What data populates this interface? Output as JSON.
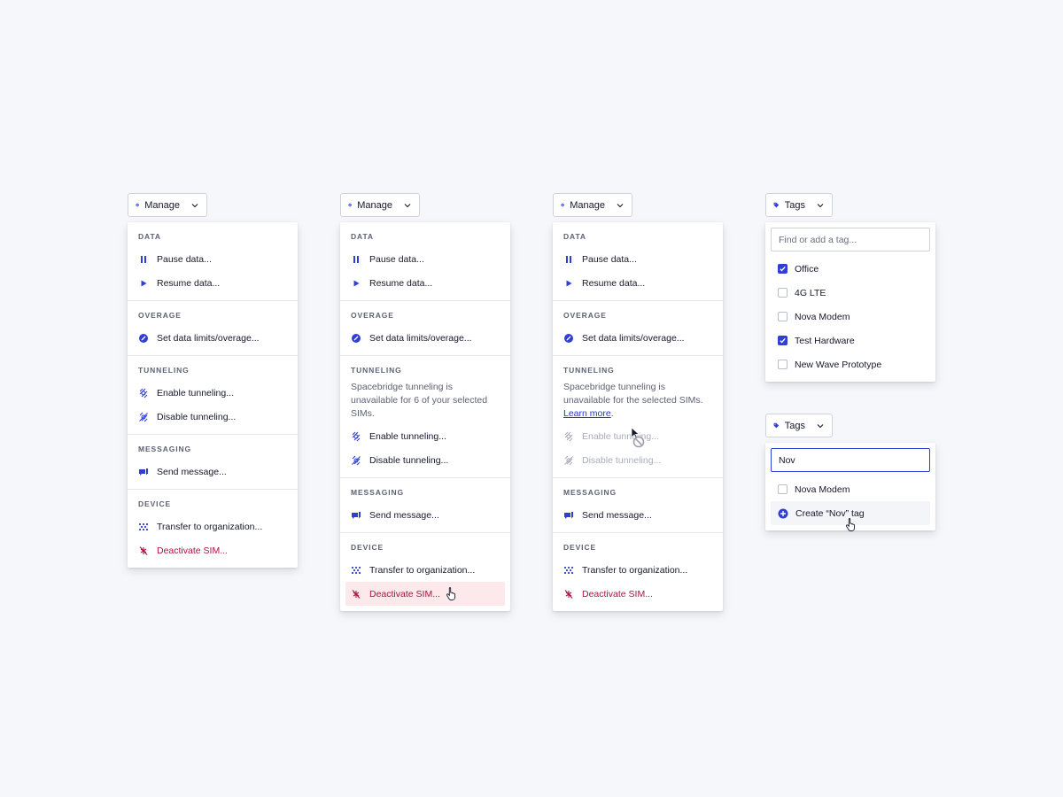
{
  "colors": {
    "accent": "#2f3fd6",
    "danger": "#b0113f",
    "danger_bg": "#fde8ec",
    "muted": "#5d6274"
  },
  "manage_menus": [
    {
      "trigger_label": "Manage",
      "sections": {
        "data": {
          "title": "DATA",
          "items": [
            "Pause data...",
            "Resume data..."
          ]
        },
        "overage": {
          "title": "OVERAGE",
          "items": [
            "Set data limits/overage..."
          ]
        },
        "tunneling": {
          "title": "TUNNELING",
          "items": [
            "Enable tunneling...",
            "Disable tunneling..."
          ]
        },
        "messaging": {
          "title": "MESSAGING",
          "items": [
            "Send message..."
          ]
        },
        "device": {
          "title": "DEVICE",
          "items": [
            "Transfer to organization...",
            "Deactivate SIM..."
          ]
        }
      }
    },
    {
      "trigger_label": "Manage",
      "sections": {
        "data": {
          "title": "DATA",
          "items": [
            "Pause data...",
            "Resume data..."
          ]
        },
        "overage": {
          "title": "OVERAGE",
          "items": [
            "Set data limits/overage..."
          ]
        },
        "tunneling": {
          "title": "TUNNELING",
          "note": "Spacebridge tunneling is unavailable for 6 of your selected SIMs.",
          "items": [
            "Enable tunneling...",
            "Disable tunneling..."
          ]
        },
        "messaging": {
          "title": "MESSAGING",
          "items": [
            "Send message..."
          ]
        },
        "device": {
          "title": "DEVICE",
          "items": [
            "Transfer to organization...",
            "Deactivate SIM..."
          ]
        }
      }
    },
    {
      "trigger_label": "Manage",
      "sections": {
        "data": {
          "title": "DATA",
          "items": [
            "Pause data...",
            "Resume data..."
          ]
        },
        "overage": {
          "title": "OVERAGE",
          "items": [
            "Set data limits/overage..."
          ]
        },
        "tunneling": {
          "title": "TUNNELING",
          "note": "Spacebridge tunneling is unavailable for the selected SIMs.",
          "note_link": "Learn more",
          "note_end": ".",
          "items": [
            "Enable tunneling...",
            "Disable tunneling..."
          ]
        },
        "messaging": {
          "title": "MESSAGING",
          "items": [
            "Send message..."
          ]
        },
        "device": {
          "title": "DEVICE",
          "items": [
            "Transfer to organization...",
            "Deactivate SIM..."
          ]
        }
      }
    }
  ],
  "tags_menu_1": {
    "trigger_label": "Tags",
    "search_placeholder": "Find or add a tag...",
    "options": [
      {
        "label": "Office",
        "checked": true
      },
      {
        "label": "4G LTE",
        "checked": false
      },
      {
        "label": "Nova Modem",
        "checked": false
      },
      {
        "label": "Test Hardware",
        "checked": true
      },
      {
        "label": "New Wave Prototype",
        "checked": false
      }
    ]
  },
  "tags_menu_2": {
    "trigger_label": "Tags",
    "search_value": "Nov",
    "options": [
      {
        "label": "Nova Modem",
        "checked": false
      }
    ],
    "create_label": "Create “Nov” tag"
  }
}
